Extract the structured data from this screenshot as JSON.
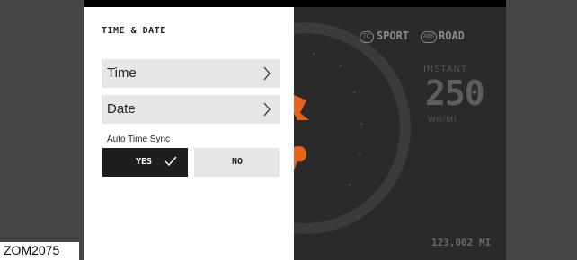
{
  "panel": {
    "title": "TIME & DATE",
    "menu": [
      {
        "label": "Time"
      },
      {
        "label": "Date"
      }
    ],
    "auto_sync": {
      "label": "Auto Time Sync",
      "yes_label": "YES",
      "no_label": "NO",
      "selected": "YES"
    }
  },
  "dashboard": {
    "tc_badge": "TC",
    "sport_label": "SPORT",
    "abs_badge": "ABS",
    "road_label": "ROAD",
    "instant_label": "INSTANT",
    "instant_value": "250",
    "instant_unit": "WH/MI",
    "odometer": "123,002 MI"
  },
  "reference_code": "ZOM2075",
  "colors": {
    "accent_orange": "#e8641e",
    "selected_bg": "#1e1e1e",
    "row_bg": "#e6e6e6"
  },
  "icons": [
    "chevron-right-icon",
    "check-icon",
    "tc-icon",
    "abs-icon",
    "warning-icon",
    "engine-icon"
  ]
}
